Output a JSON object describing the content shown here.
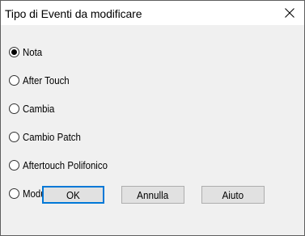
{
  "window": {
    "title": "Tipo di Eventi da modificare"
  },
  "options": [
    {
      "label": "Nota",
      "selected": true
    },
    {
      "label": "After Touch",
      "selected": false
    },
    {
      "label": "Cambia",
      "selected": false
    },
    {
      "label": "Cambio Patch",
      "selected": false
    },
    {
      "label": "Aftertouch Polifonico",
      "selected": false
    },
    {
      "label": "Modula Tono",
      "selected": false
    }
  ],
  "buttons": {
    "ok": "OK",
    "cancel": "Annulla",
    "help": "Aiuto"
  },
  "icons": {
    "close": "close-icon"
  },
  "colors": {
    "dialog_bg": "#f0f0f0",
    "button_bg": "#e1e1e1",
    "default_border": "#0078d7"
  }
}
